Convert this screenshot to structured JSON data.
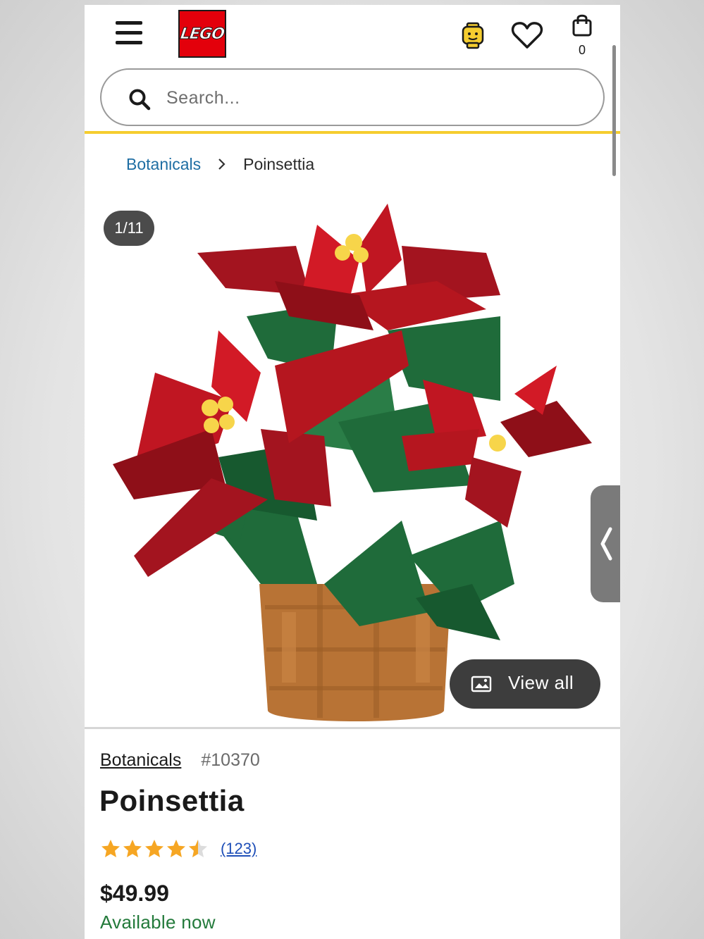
{
  "header": {
    "logo_text": "LEGO",
    "bag_count": "0",
    "icons": {
      "menu": "hamburger-menu-icon",
      "account": "minifigure-head-icon",
      "wishlist": "heart-icon",
      "bag": "shopping-bag-icon"
    }
  },
  "search": {
    "placeholder": "Search..."
  },
  "breadcrumb": {
    "parent": "Botanicals",
    "current": "Poinsettia"
  },
  "gallery": {
    "counter": "1/11",
    "view_all_label": "View all"
  },
  "product": {
    "theme": "Botanicals",
    "item_number": "#10370",
    "title": "Poinsettia",
    "rating": 4.5,
    "rating_max": 5,
    "review_count": "(123)",
    "price": "$49.99",
    "availability": "Available now"
  },
  "colors": {
    "lego_red": "#e3000b",
    "accent_yellow": "#f5cd2f",
    "link_blue": "#1f6ea3",
    "available_green": "#237a3b",
    "star_gold": "#f6a623"
  }
}
